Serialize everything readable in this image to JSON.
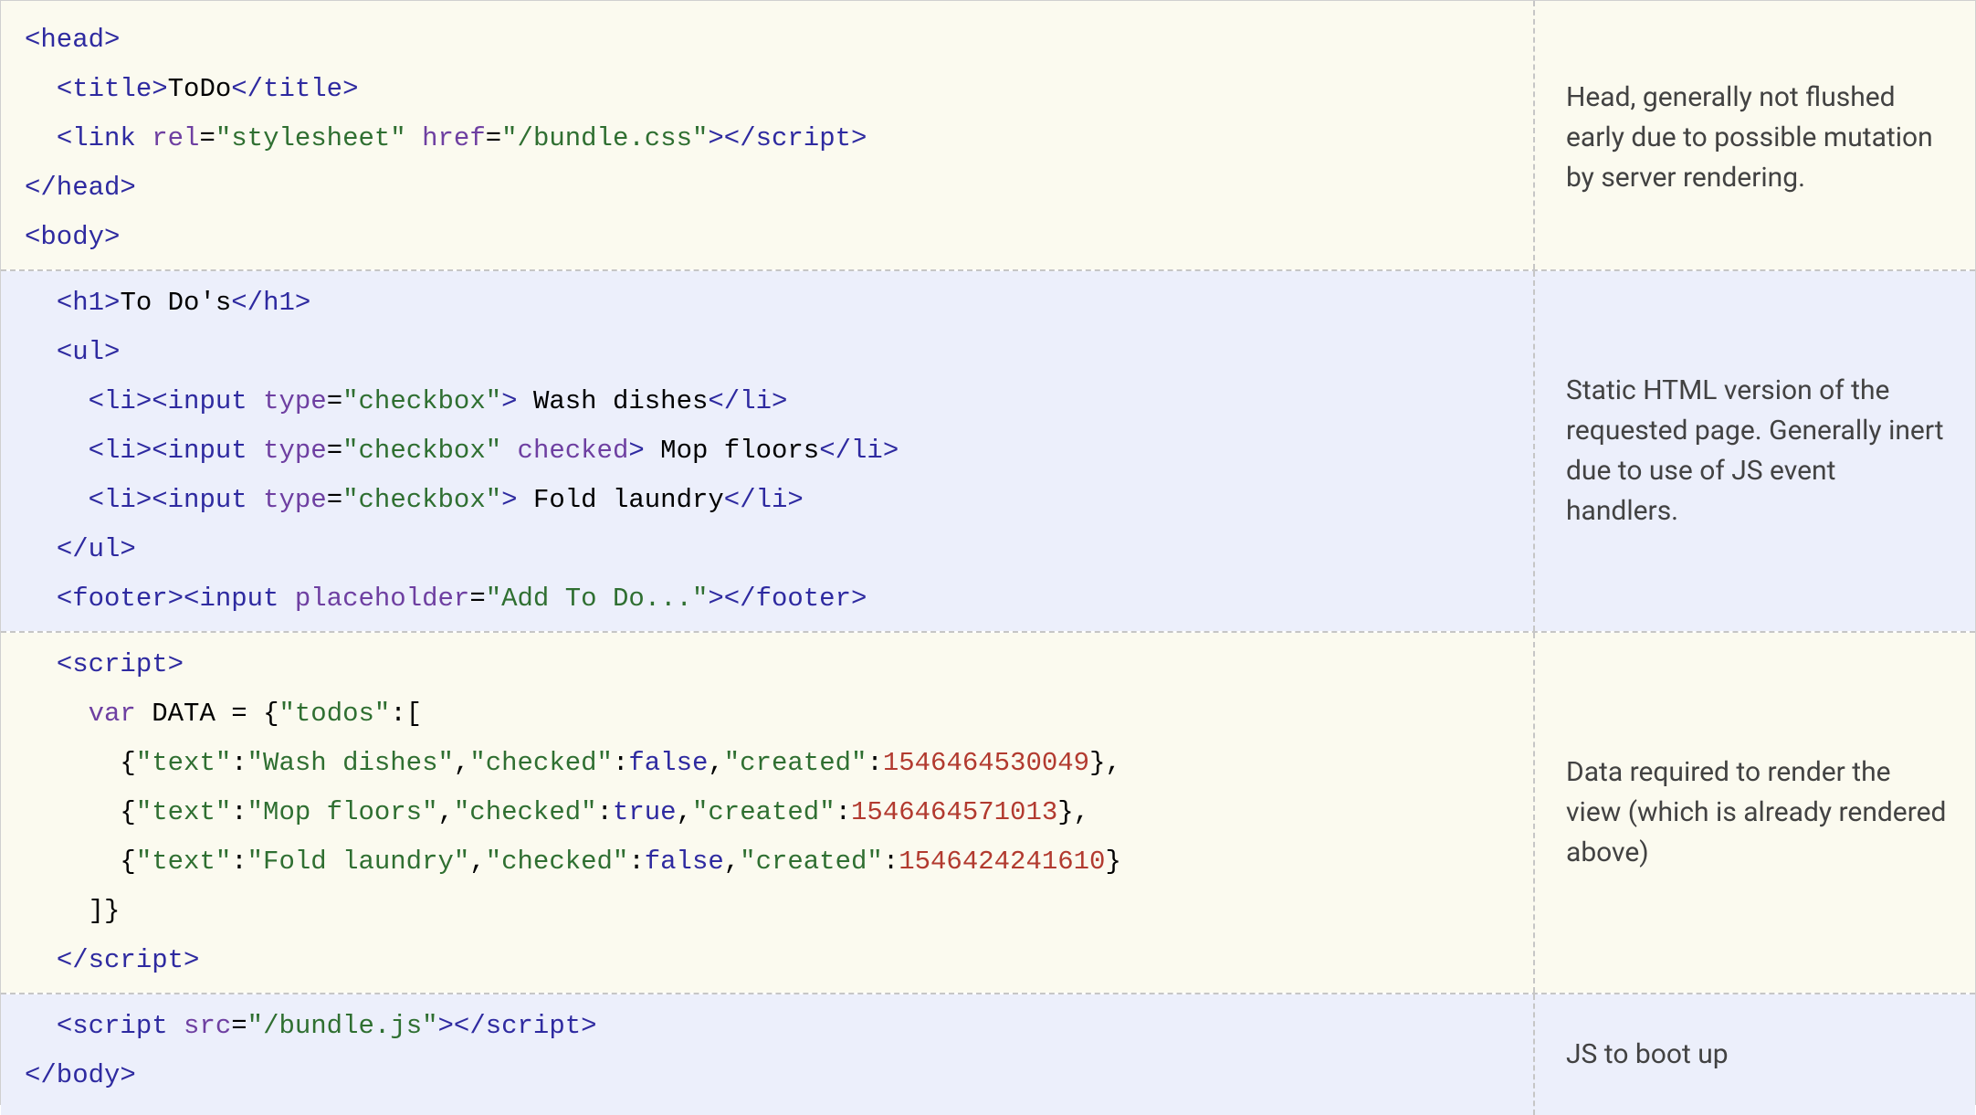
{
  "rows": [
    {
      "bg": "bg-cream",
      "comment": "Head, generally not flushed early due to possible mutation by server rendering.",
      "lines": [
        [
          {
            "c": "tag",
            "t": "<head>"
          }
        ],
        [
          {
            "c": "plain",
            "t": "  "
          },
          {
            "c": "tag",
            "t": "<title>"
          },
          {
            "c": "plain",
            "t": "ToDo"
          },
          {
            "c": "tag",
            "t": "</title>"
          }
        ],
        [
          {
            "c": "plain",
            "t": "  "
          },
          {
            "c": "tag",
            "t": "<link"
          },
          {
            "c": "plain",
            "t": " "
          },
          {
            "c": "attr",
            "t": "rel"
          },
          {
            "c": "plain",
            "t": "="
          },
          {
            "c": "str",
            "t": "\"stylesheet\""
          },
          {
            "c": "plain",
            "t": " "
          },
          {
            "c": "attr",
            "t": "href"
          },
          {
            "c": "plain",
            "t": "="
          },
          {
            "c": "str",
            "t": "\"/bundle.css\""
          },
          {
            "c": "tag",
            "t": ">"
          },
          {
            "c": "tag",
            "t": "</script"
          },
          {
            "c": "tag",
            "t": ">"
          }
        ],
        [
          {
            "c": "tag",
            "t": "</head>"
          }
        ],
        [
          {
            "c": "tag",
            "t": "<body>"
          }
        ]
      ]
    },
    {
      "bg": "bg-blue",
      "comment": "Static HTML version of the requested page. Generally inert due to use of JS event handlers.",
      "lines": [
        [
          {
            "c": "plain",
            "t": "  "
          },
          {
            "c": "tag",
            "t": "<h1>"
          },
          {
            "c": "plain",
            "t": "To Do's"
          },
          {
            "c": "tag",
            "t": "</h1>"
          }
        ],
        [
          {
            "c": "plain",
            "t": "  "
          },
          {
            "c": "tag",
            "t": "<ul>"
          }
        ],
        [
          {
            "c": "plain",
            "t": "    "
          },
          {
            "c": "tag",
            "t": "<li>"
          },
          {
            "c": "tag",
            "t": "<input"
          },
          {
            "c": "plain",
            "t": " "
          },
          {
            "c": "attr",
            "t": "type"
          },
          {
            "c": "plain",
            "t": "="
          },
          {
            "c": "str",
            "t": "\"checkbox\""
          },
          {
            "c": "tag",
            "t": ">"
          },
          {
            "c": "plain",
            "t": " Wash dishes"
          },
          {
            "c": "tag",
            "t": "</li>"
          }
        ],
        [
          {
            "c": "plain",
            "t": "    "
          },
          {
            "c": "tag",
            "t": "<li>"
          },
          {
            "c": "tag",
            "t": "<input"
          },
          {
            "c": "plain",
            "t": " "
          },
          {
            "c": "attr",
            "t": "type"
          },
          {
            "c": "plain",
            "t": "="
          },
          {
            "c": "str",
            "t": "\"checkbox\""
          },
          {
            "c": "plain",
            "t": " "
          },
          {
            "c": "attr",
            "t": "checked"
          },
          {
            "c": "tag",
            "t": ">"
          },
          {
            "c": "plain",
            "t": " Mop floors"
          },
          {
            "c": "tag",
            "t": "</li>"
          }
        ],
        [
          {
            "c": "plain",
            "t": "    "
          },
          {
            "c": "tag",
            "t": "<li>"
          },
          {
            "c": "tag",
            "t": "<input"
          },
          {
            "c": "plain",
            "t": " "
          },
          {
            "c": "attr",
            "t": "type"
          },
          {
            "c": "plain",
            "t": "="
          },
          {
            "c": "str",
            "t": "\"checkbox\""
          },
          {
            "c": "tag",
            "t": ">"
          },
          {
            "c": "plain",
            "t": " Fold laundry"
          },
          {
            "c": "tag",
            "t": "</li>"
          }
        ],
        [
          {
            "c": "plain",
            "t": "  "
          },
          {
            "c": "tag",
            "t": "</ul>"
          }
        ],
        [
          {
            "c": "plain",
            "t": "  "
          },
          {
            "c": "tag",
            "t": "<footer>"
          },
          {
            "c": "tag",
            "t": "<input"
          },
          {
            "c": "plain",
            "t": " "
          },
          {
            "c": "attr",
            "t": "placeholder"
          },
          {
            "c": "plain",
            "t": "="
          },
          {
            "c": "str",
            "t": "\"Add To Do...\""
          },
          {
            "c": "tag",
            "t": ">"
          },
          {
            "c": "tag",
            "t": "</footer>"
          }
        ]
      ]
    },
    {
      "bg": "bg-cream",
      "comment": "Data required to render the view (which is already rendered above)",
      "lines": [
        [
          {
            "c": "plain",
            "t": "  "
          },
          {
            "c": "tag",
            "t": "<script"
          },
          {
            "c": "tag",
            "t": ">"
          }
        ],
        [
          {
            "c": "plain",
            "t": "    "
          },
          {
            "c": "kw",
            "t": "var"
          },
          {
            "c": "plain",
            "t": " DATA = {"
          },
          {
            "c": "str",
            "t": "\"todos\""
          },
          {
            "c": "plain",
            "t": ":["
          }
        ],
        [
          {
            "c": "plain",
            "t": "      {"
          },
          {
            "c": "str",
            "t": "\"text\""
          },
          {
            "c": "plain",
            "t": ":"
          },
          {
            "c": "str",
            "t": "\"Wash dishes\""
          },
          {
            "c": "plain",
            "t": ","
          },
          {
            "c": "str",
            "t": "\"checked\""
          },
          {
            "c": "plain",
            "t": ":"
          },
          {
            "c": "bool",
            "t": "false"
          },
          {
            "c": "plain",
            "t": ","
          },
          {
            "c": "str",
            "t": "\"created\""
          },
          {
            "c": "plain",
            "t": ":"
          },
          {
            "c": "num",
            "t": "1546464530049"
          },
          {
            "c": "plain",
            "t": "},"
          }
        ],
        [
          {
            "c": "plain",
            "t": "      {"
          },
          {
            "c": "str",
            "t": "\"text\""
          },
          {
            "c": "plain",
            "t": ":"
          },
          {
            "c": "str",
            "t": "\"Mop floors\""
          },
          {
            "c": "plain",
            "t": ","
          },
          {
            "c": "str",
            "t": "\"checked\""
          },
          {
            "c": "plain",
            "t": ":"
          },
          {
            "c": "bool",
            "t": "true"
          },
          {
            "c": "plain",
            "t": ","
          },
          {
            "c": "str",
            "t": "\"created\""
          },
          {
            "c": "plain",
            "t": ":"
          },
          {
            "c": "num",
            "t": "1546464571013"
          },
          {
            "c": "plain",
            "t": "},"
          }
        ],
        [
          {
            "c": "plain",
            "t": "      {"
          },
          {
            "c": "str",
            "t": "\"text\""
          },
          {
            "c": "plain",
            "t": ":"
          },
          {
            "c": "str",
            "t": "\"Fold laundry\""
          },
          {
            "c": "plain",
            "t": ","
          },
          {
            "c": "str",
            "t": "\"checked\""
          },
          {
            "c": "plain",
            "t": ":"
          },
          {
            "c": "bool",
            "t": "false"
          },
          {
            "c": "plain",
            "t": ","
          },
          {
            "c": "str",
            "t": "\"created\""
          },
          {
            "c": "plain",
            "t": ":"
          },
          {
            "c": "num",
            "t": "1546424241610"
          },
          {
            "c": "plain",
            "t": "}"
          }
        ],
        [
          {
            "c": "plain",
            "t": "    ]}"
          }
        ],
        [
          {
            "c": "plain",
            "t": "  "
          },
          {
            "c": "tag",
            "t": "</script"
          },
          {
            "c": "tag",
            "t": ">"
          }
        ]
      ]
    },
    {
      "bg": "bg-blue",
      "comment": "JS to boot up",
      "lines": [
        [
          {
            "c": "plain",
            "t": "  "
          },
          {
            "c": "tag",
            "t": "<script"
          },
          {
            "c": "plain",
            "t": " "
          },
          {
            "c": "attr",
            "t": "src"
          },
          {
            "c": "plain",
            "t": "="
          },
          {
            "c": "str",
            "t": "\"/bundle.js\""
          },
          {
            "c": "tag",
            "t": ">"
          },
          {
            "c": "tag",
            "t": "</script"
          },
          {
            "c": "tag",
            "t": ">"
          }
        ],
        [
          {
            "c": "tag",
            "t": "</body>"
          }
        ]
      ]
    }
  ]
}
